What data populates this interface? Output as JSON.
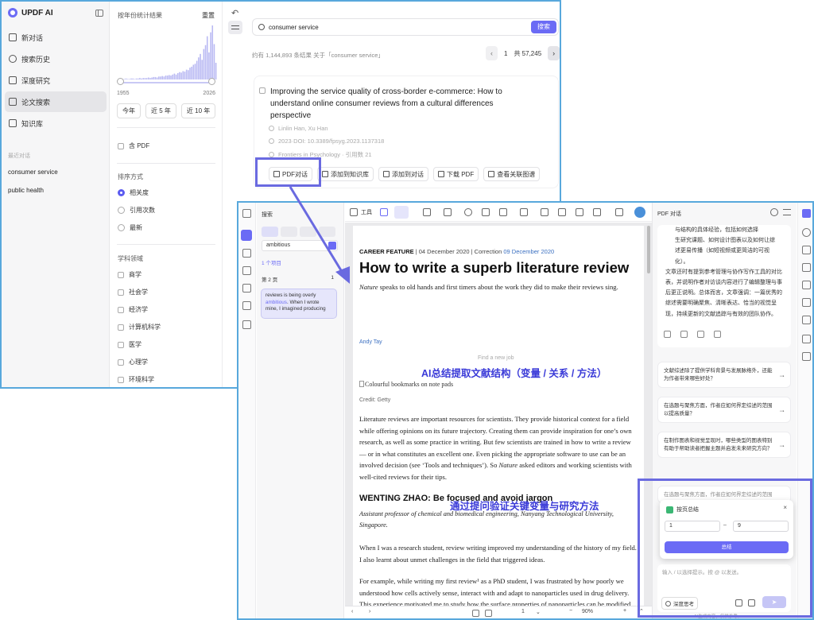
{
  "colors": {
    "accent": "#6b6bf5",
    "window_border": "#58a8dc",
    "highlight_box": "#6a6ae0",
    "overlay_text": "#3a3ad8"
  },
  "search_window": {
    "sidebar": {
      "app_name": "UPDF AI",
      "nav": [
        {
          "label": "新对话",
          "icon": "chat-icon"
        },
        {
          "label": "搜索历史",
          "icon": "search-icon"
        },
        {
          "label": "深度研究",
          "icon": "research-icon"
        },
        {
          "label": "论文搜索",
          "icon": "paper-search-icon",
          "active": true
        },
        {
          "label": "知识库",
          "icon": "library-icon"
        }
      ],
      "recent_label": "最近对话",
      "recent": [
        "consumer service",
        "public health"
      ]
    },
    "filters": {
      "title": "按年份统计结果",
      "reset": "重置",
      "histogram": [
        1,
        1,
        1,
        1,
        2,
        1,
        1,
        2,
        2,
        1,
        2,
        2,
        3,
        2,
        3,
        3,
        3,
        4,
        3,
        4,
        5,
        5,
        4,
        6,
        6,
        7,
        6,
        8,
        8,
        9,
        8,
        10,
        12,
        10,
        13,
        15,
        14,
        17,
        16,
        20,
        19,
        24,
        26,
        30,
        32,
        38,
        45,
        52,
        40,
        62,
        70,
        88,
        55,
        96,
        110,
        72,
        34
      ],
      "year_min": "1955",
      "year_max": "2026",
      "year_buttons": [
        "今年",
        "近 5 年",
        "近 10 年"
      ],
      "pdf_label": "含 PDF",
      "sort_title": "排序方式",
      "sort_options": [
        {
          "label": "相关度",
          "selected": true
        },
        {
          "label": "引用次数",
          "selected": false
        },
        {
          "label": "最新",
          "selected": false
        }
      ],
      "subject_title": "学科领域",
      "subjects": [
        "商学",
        "社会学",
        "经济学",
        "计算机科学",
        "医学",
        "心理学",
        "环境科学"
      ]
    },
    "main": {
      "back": "↶",
      "search_value": "consumer service",
      "search_button": "搜索",
      "results_info": "约有 1,144,893 条结果 关于「consumer service」",
      "page_current": "1",
      "page_total": "共 57,245",
      "result": {
        "title": "Improving the service quality of cross-border e-commerce: How to understand online consumer reviews from a cultural differences perspective",
        "authors": "Linlin Han, Xu Han",
        "doi": "2023·DOI: 10.3389/fpsyg.2023.1137318",
        "journal": "Frontiers in Psychology · 引用数 21",
        "actions": [
          "PDF对话",
          "添加到知识库",
          "添加到对话",
          "下载 PDF",
          "查看关联图谱"
        ]
      }
    }
  },
  "reader_window": {
    "search_panel": {
      "title": "搜索",
      "query": "ambitious",
      "count": "1 个项目",
      "page_label": "第 2 页",
      "page_hits": "1",
      "result_pre": "reviews is being overly ",
      "result_hl": "ambitious",
      "result_post": ". When I wrote mine, I imagined producing"
    },
    "toolbar": {
      "tools_label": "工具"
    },
    "document": {
      "kicker": "CAREER FEATURE",
      "date": "04 December 2020",
      "correction_label": "Correction",
      "correction_date": "09 December 2020",
      "title": "How to write a superb literature review",
      "standfirst_em": "Nature",
      "standfirst": " speaks to old hands and first timers about the work they did to make their reviews sing.",
      "author": "Andy Tay",
      "find_job": "Find a new job",
      "image_alt": "Colourful bookmarks on note pads",
      "credit": "Credit: Getty",
      "para1_a": "Literature reviews are important resources for scientists. They provide historical context for a field while offering opinions on its future trajectory. Creating them can provide inspiration for one’s own research, as well as some practice in writing. But few scientists are trained in how to write a review — or in what constitutes an excellent one. Even picking the appropriate software to use can be an involved decision (see ‘Tools and techniques’). So ",
      "para1_em": "Nature",
      "para1_b": " asked editors and working scientists with well-cited reviews for their tips.",
      "subhead": "WENTING ZHAO: Be focused and avoid jargon",
      "affiliation": "Assistant professor of chemical and biomedical engineering, Nanyang Technological University, Singapore.",
      "para2": "When I was a research student, review writing improved my understanding of the history of my field. I also learnt about unmet challenges in the field that triggered ideas.",
      "para3": "For example, while writing my first review¹ as a PhD student, I was frustrated by how poorly we understood how cells actively sense, interact with and adapt to nanoparticles used in drug delivery. This experience motivated me to study how the surface properties of nanoparticles can be modified to enhance biological sensing. When I transitioned to my postdoctoral research, this question led me to discover the role of cell-membrane curvature, which led to"
    },
    "overlay_1": "AI总结提取文献结构（变量 / 关系 / 方法）",
    "overlay_2": "通过提问验证关键变量与研究方法",
    "bottom": {
      "page": "1",
      "zoom": "90%"
    },
    "chat": {
      "title": "PDF 对话",
      "lines_indented": [
        "与结构的具体经验，包括如何选择",
        "生研究课题、如何设计图表以及如何让综",
        "述更易传播（如短视频或更简洁的可视",
        "化）。"
      ],
      "lines": [
        "文章还时有提到参考管理与协作写作工具的对比",
        "表，并说明作者对访谈内容进行了编辑整理与事",
        "后更正说明。总体而言，文章强调：一篇优秀的",
        "综述需要明确聚焦、清晰表达、恰当的视觉呈",
        "现，持续更新的文献追踪与有效的团队协作。"
      ],
      "suggestions": [
        "文献综述除了提供学科背景与发展脉络外，还能为作者带来哪些好处？",
        "在选题与聚焦方面，作者应如何界定综述的范围以提高质量？",
        "在制作图表和视觉呈现时，哪些类型的图表特别有助于帮助读者把握主题并启发未来研究方向？"
      ],
      "hidden_suggestion": "在选题与聚焦方面，作者应如何界定综述的范围",
      "input_placeholder": "输入 / 以选择提示。按 @ 以发送。",
      "deep_think": "深度思考",
      "send": "➤",
      "footer": "AI生成内容，仅供参考。"
    },
    "summary_dialog": {
      "title": "按页总结",
      "from": "1",
      "to": "9",
      "dash": "–",
      "close": "×",
      "button": "总结"
    }
  }
}
